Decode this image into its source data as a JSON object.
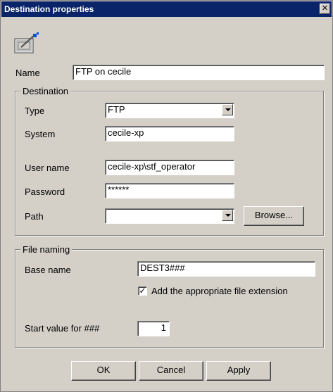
{
  "window": {
    "title": "Destination properties",
    "close_glyph": "✕"
  },
  "name": {
    "label": "Name",
    "value": "FTP on cecile"
  },
  "destination": {
    "group_title": "Destination",
    "type": {
      "label": "Type",
      "value": "FTP"
    },
    "system": {
      "label": "System",
      "value": "cecile-xp"
    },
    "user_name": {
      "label": "User name",
      "value": "cecile-xp\\stf_operator"
    },
    "password": {
      "label": "Password",
      "value": "******"
    },
    "path": {
      "label": "Path",
      "value": ""
    },
    "browse_label": "Browse..."
  },
  "file_naming": {
    "group_title": "File naming",
    "base_name": {
      "label": "Base name",
      "value": "DEST3###"
    },
    "extension_checkbox": {
      "label": "Add the appropriate file extension",
      "checked": true,
      "check_glyph": "✓"
    },
    "start_value": {
      "label": "Start value for ###",
      "value": "1"
    }
  },
  "buttons": {
    "ok": "OK",
    "cancel": "Cancel",
    "apply": "Apply"
  },
  "icons": {
    "header": "properties-edit-icon"
  },
  "colors": {
    "titlebar": "#0a246a",
    "face": "#d4d0c8"
  }
}
